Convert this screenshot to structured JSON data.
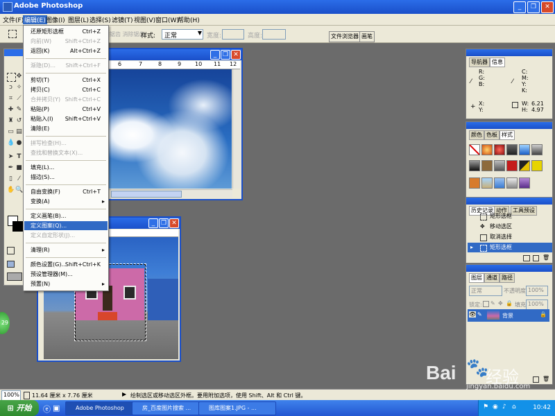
{
  "app": {
    "title": "Adobe Photoshop"
  },
  "menubar": [
    "文件(F)",
    "编辑(E)",
    "图像(I)",
    "图层(L)",
    "选择(S)",
    "滤镜(T)",
    "视图(V)",
    "窗口(W)",
    "帮助(H)"
  ],
  "options": {
    "hidden_text": "除锯齿 消除锯齿",
    "style_label": "样式:",
    "style_value": "正常",
    "width_label": "宽度:",
    "height_label": "高度:",
    "tab_file_browser": "文件浏览器",
    "tab_brushes": "画笔"
  },
  "edit_menu": [
    {
      "label": "还原矩形选框",
      "shortcut": "Ctrl+Z",
      "disabled": false
    },
    {
      "label": "向前(W)",
      "shortcut": "Shift+Ctrl+Z",
      "disabled": true
    },
    {
      "label": "返回(K)",
      "shortcut": "Alt+Ctrl+Z",
      "disabled": false
    },
    {
      "label": "渐隐(D)...",
      "shortcut": "Shift+Ctrl+F",
      "disabled": true
    },
    {
      "label": "剪切(T)",
      "shortcut": "Ctrl+X",
      "disabled": false
    },
    {
      "label": "拷贝(C)",
      "shortcut": "Ctrl+C",
      "disabled": false
    },
    {
      "label": "合并拷贝(Y)",
      "shortcut": "Shift+Ctrl+C",
      "disabled": true
    },
    {
      "label": "粘贴(P)",
      "shortcut": "Ctrl+V",
      "disabled": false
    },
    {
      "label": "粘贴入(I)",
      "shortcut": "Shift+Ctrl+V",
      "disabled": false
    },
    {
      "label": "清除(E)",
      "shortcut": "",
      "disabled": false
    },
    {
      "label": "拼写检查(H)...",
      "shortcut": "",
      "disabled": true
    },
    {
      "label": "查找和替换文本(X)...",
      "shortcut": "",
      "disabled": true
    },
    {
      "label": "填充(L)...",
      "shortcut": "",
      "disabled": false
    },
    {
      "label": "描边(S)...",
      "shortcut": "",
      "disabled": false
    },
    {
      "label": "自由变换(F)",
      "shortcut": "Ctrl+T",
      "disabled": false
    },
    {
      "label": "变换(A)",
      "shortcut": "",
      "disabled": false
    },
    {
      "label": "定义画笔(B)...",
      "shortcut": "",
      "disabled": false
    },
    {
      "label": "定义图案(Q)...",
      "shortcut": "",
      "disabled": false,
      "highlighted": true
    },
    {
      "label": "定义自定形状(J)...",
      "shortcut": "",
      "disabled": true
    },
    {
      "label": "清理(R)",
      "shortcut": "",
      "disabled": false
    },
    {
      "label": "颜色设置(G)...",
      "shortcut": "Shift+Ctrl+K",
      "disabled": false
    },
    {
      "label": "预设管理器(M)...",
      "shortcut": "",
      "disabled": false
    },
    {
      "label": "预置(N)",
      "shortcut": "",
      "disabled": false
    }
  ],
  "ruler_ticks": [
    "6",
    "7",
    "8",
    "9",
    "10",
    "11",
    "12"
  ],
  "navigator": {
    "tabs": [
      "导航器",
      "信息"
    ],
    "rgb": "R:\nG:\nB:",
    "cmyk": "C:\nM:\nY:\nK:",
    "xy": "X:\nY:",
    "w_label": "W:",
    "h_label": "H:",
    "w_value": "6.21",
    "h_value": "4.97"
  },
  "color_panel": {
    "tabs": [
      "颜色",
      "色板",
      "样式"
    ]
  },
  "history_panel": {
    "tabs": [
      "历史记录",
      "动作",
      "工具预设"
    ],
    "items": [
      "矩形选框",
      "移动选区",
      "取消选择",
      "矩形选框"
    ]
  },
  "layers_panel": {
    "tabs": [
      "图层",
      "通道",
      "路径"
    ],
    "blend": "正常",
    "opacity_label": "不透明度:",
    "opacity": "100%",
    "lock_label": "锁定:",
    "fill_label": "填充:",
    "fill": "100%",
    "layer_name": "背景"
  },
  "status": {
    "zoom": "100%",
    "doc_size": "11.64 厘米 x 7.76 厘米",
    "hint": "绘制选区或移动选区外框。要用附加选项，使用 Shift、Alt 和 Ctrl 键。"
  },
  "taskbar": {
    "start": "开始",
    "tasks": [
      "Adobe Photoshop",
      "房_百度图片搜索 ...",
      "图库图案1.JPG - ..."
    ],
    "time": "10:42"
  },
  "watermark": {
    "brand": "Bai",
    "site": "jingyan.baidu.com",
    "name": "经验"
  },
  "colors": {
    "title_blue": "#1a4fc9",
    "menu_highlight": "#316ac5",
    "workspace": "#6b6b6b"
  }
}
